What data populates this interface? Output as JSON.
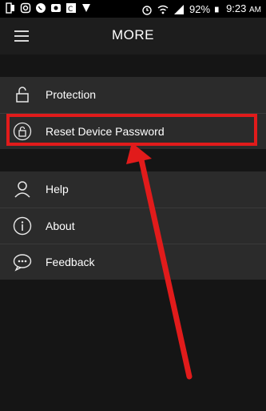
{
  "status_bar": {
    "battery": "92%",
    "time": "9:23",
    "time_suffix": "AM"
  },
  "header": {
    "title": "MORE"
  },
  "menu": {
    "section1": [
      {
        "label": "Protection",
        "icon": "lock-open-icon"
      },
      {
        "label": "Reset Device Password",
        "icon": "lock-reset-icon"
      }
    ],
    "section2": [
      {
        "label": "Help",
        "icon": "person-icon"
      },
      {
        "label": "About",
        "icon": "info-icon"
      },
      {
        "label": "Feedback",
        "icon": "chat-bubble-icon"
      }
    ]
  },
  "annotation": {
    "highlight_color": "#e11b1b"
  }
}
